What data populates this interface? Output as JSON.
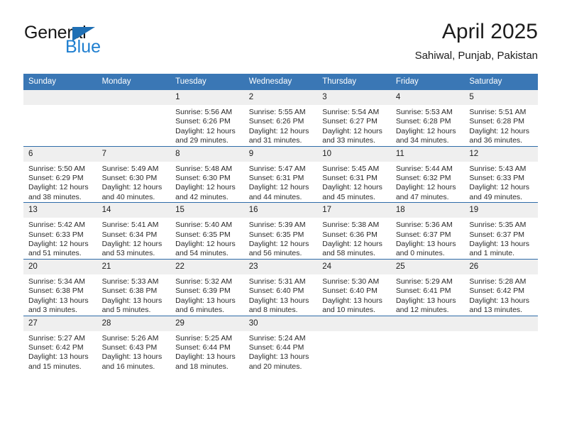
{
  "brand": {
    "name_part1": "General",
    "name_part2": "Blue",
    "triangle_icon": "brand-triangle-icon",
    "colors": {
      "black": "#161616",
      "blue": "#1f7fd0",
      "triangle": "#1f6fb4"
    }
  },
  "header": {
    "title": "April 2025",
    "subtitle": "Sahiwal, Punjab, Pakistan"
  },
  "theme": {
    "header_blue": "#3a77b5",
    "rule_blue": "#2f6ca8",
    "daynum_band": "#efefef",
    "text": "#2a2a2a"
  },
  "columns": [
    "Sunday",
    "Monday",
    "Tuesday",
    "Wednesday",
    "Thursday",
    "Friday",
    "Saturday"
  ],
  "labels": {
    "sunrise_prefix": "Sunrise:",
    "sunset_prefix": "Sunset:",
    "daylight_prefix": "Daylight:"
  },
  "weeks": [
    [
      {
        "day": "",
        "blank": true
      },
      {
        "day": "",
        "blank": true
      },
      {
        "day": "1",
        "sunrise": "Sunrise: 5:56 AM",
        "sunset": "Sunset: 6:26 PM",
        "daylight": "Daylight: 12 hours and 29 minutes."
      },
      {
        "day": "2",
        "sunrise": "Sunrise: 5:55 AM",
        "sunset": "Sunset: 6:26 PM",
        "daylight": "Daylight: 12 hours and 31 minutes."
      },
      {
        "day": "3",
        "sunrise": "Sunrise: 5:54 AM",
        "sunset": "Sunset: 6:27 PM",
        "daylight": "Daylight: 12 hours and 33 minutes."
      },
      {
        "day": "4",
        "sunrise": "Sunrise: 5:53 AM",
        "sunset": "Sunset: 6:28 PM",
        "daylight": "Daylight: 12 hours and 34 minutes."
      },
      {
        "day": "5",
        "sunrise": "Sunrise: 5:51 AM",
        "sunset": "Sunset: 6:28 PM",
        "daylight": "Daylight: 12 hours and 36 minutes."
      }
    ],
    [
      {
        "day": "6",
        "sunrise": "Sunrise: 5:50 AM",
        "sunset": "Sunset: 6:29 PM",
        "daylight": "Daylight: 12 hours and 38 minutes."
      },
      {
        "day": "7",
        "sunrise": "Sunrise: 5:49 AM",
        "sunset": "Sunset: 6:30 PM",
        "daylight": "Daylight: 12 hours and 40 minutes."
      },
      {
        "day": "8",
        "sunrise": "Sunrise: 5:48 AM",
        "sunset": "Sunset: 6:30 PM",
        "daylight": "Daylight: 12 hours and 42 minutes."
      },
      {
        "day": "9",
        "sunrise": "Sunrise: 5:47 AM",
        "sunset": "Sunset: 6:31 PM",
        "daylight": "Daylight: 12 hours and 44 minutes."
      },
      {
        "day": "10",
        "sunrise": "Sunrise: 5:45 AM",
        "sunset": "Sunset: 6:31 PM",
        "daylight": "Daylight: 12 hours and 45 minutes."
      },
      {
        "day": "11",
        "sunrise": "Sunrise: 5:44 AM",
        "sunset": "Sunset: 6:32 PM",
        "daylight": "Daylight: 12 hours and 47 minutes."
      },
      {
        "day": "12",
        "sunrise": "Sunrise: 5:43 AM",
        "sunset": "Sunset: 6:33 PM",
        "daylight": "Daylight: 12 hours and 49 minutes."
      }
    ],
    [
      {
        "day": "13",
        "sunrise": "Sunrise: 5:42 AM",
        "sunset": "Sunset: 6:33 PM",
        "daylight": "Daylight: 12 hours and 51 minutes."
      },
      {
        "day": "14",
        "sunrise": "Sunrise: 5:41 AM",
        "sunset": "Sunset: 6:34 PM",
        "daylight": "Daylight: 12 hours and 53 minutes."
      },
      {
        "day": "15",
        "sunrise": "Sunrise: 5:40 AM",
        "sunset": "Sunset: 6:35 PM",
        "daylight": "Daylight: 12 hours and 54 minutes."
      },
      {
        "day": "16",
        "sunrise": "Sunrise: 5:39 AM",
        "sunset": "Sunset: 6:35 PM",
        "daylight": "Daylight: 12 hours and 56 minutes."
      },
      {
        "day": "17",
        "sunrise": "Sunrise: 5:38 AM",
        "sunset": "Sunset: 6:36 PM",
        "daylight": "Daylight: 12 hours and 58 minutes."
      },
      {
        "day": "18",
        "sunrise": "Sunrise: 5:36 AM",
        "sunset": "Sunset: 6:37 PM",
        "daylight": "Daylight: 13 hours and 0 minutes."
      },
      {
        "day": "19",
        "sunrise": "Sunrise: 5:35 AM",
        "sunset": "Sunset: 6:37 PM",
        "daylight": "Daylight: 13 hours and 1 minute."
      }
    ],
    [
      {
        "day": "20",
        "sunrise": "Sunrise: 5:34 AM",
        "sunset": "Sunset: 6:38 PM",
        "daylight": "Daylight: 13 hours and 3 minutes."
      },
      {
        "day": "21",
        "sunrise": "Sunrise: 5:33 AM",
        "sunset": "Sunset: 6:38 PM",
        "daylight": "Daylight: 13 hours and 5 minutes."
      },
      {
        "day": "22",
        "sunrise": "Sunrise: 5:32 AM",
        "sunset": "Sunset: 6:39 PM",
        "daylight": "Daylight: 13 hours and 6 minutes."
      },
      {
        "day": "23",
        "sunrise": "Sunrise: 5:31 AM",
        "sunset": "Sunset: 6:40 PM",
        "daylight": "Daylight: 13 hours and 8 minutes."
      },
      {
        "day": "24",
        "sunrise": "Sunrise: 5:30 AM",
        "sunset": "Sunset: 6:40 PM",
        "daylight": "Daylight: 13 hours and 10 minutes."
      },
      {
        "day": "25",
        "sunrise": "Sunrise: 5:29 AM",
        "sunset": "Sunset: 6:41 PM",
        "daylight": "Daylight: 13 hours and 12 minutes."
      },
      {
        "day": "26",
        "sunrise": "Sunrise: 5:28 AM",
        "sunset": "Sunset: 6:42 PM",
        "daylight": "Daylight: 13 hours and 13 minutes."
      }
    ],
    [
      {
        "day": "27",
        "sunrise": "Sunrise: 5:27 AM",
        "sunset": "Sunset: 6:42 PM",
        "daylight": "Daylight: 13 hours and 15 minutes."
      },
      {
        "day": "28",
        "sunrise": "Sunrise: 5:26 AM",
        "sunset": "Sunset: 6:43 PM",
        "daylight": "Daylight: 13 hours and 16 minutes."
      },
      {
        "day": "29",
        "sunrise": "Sunrise: 5:25 AM",
        "sunset": "Sunset: 6:44 PM",
        "daylight": "Daylight: 13 hours and 18 minutes."
      },
      {
        "day": "30",
        "sunrise": "Sunrise: 5:24 AM",
        "sunset": "Sunset: 6:44 PM",
        "daylight": "Daylight: 13 hours and 20 minutes."
      },
      {
        "day": "",
        "blank": true
      },
      {
        "day": "",
        "blank": true
      },
      {
        "day": "",
        "blank": true
      }
    ]
  ]
}
